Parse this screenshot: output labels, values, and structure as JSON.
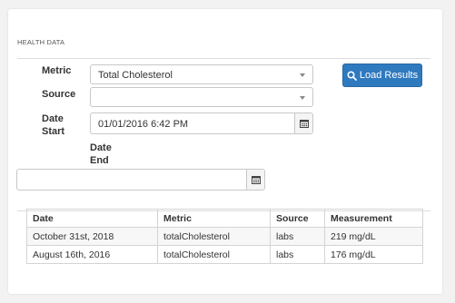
{
  "section_title": "HEALTH DATA",
  "form": {
    "metric_label": "Metric",
    "metric_value": "Total Cholesterol",
    "source_label": "Source",
    "source_value": "",
    "date_start_label_line1": "Date",
    "date_start_label_line2": "Start",
    "date_start_value": "01/01/2016 6:42 PM",
    "date_end_label_line1": "Date",
    "date_end_label_line2": "End",
    "date_end_value": ""
  },
  "load_button_label": "Load Results",
  "table": {
    "headers": [
      "Date",
      "Metric",
      "Source",
      "Measurement"
    ],
    "rows": [
      [
        "October 31st, 2018",
        "totalCholesterol",
        "labs",
        "219 mg/dL"
      ],
      [
        "August 16th, 2016",
        "totalCholesterol",
        "labs",
        "176 mg/dL"
      ]
    ]
  },
  "colors": {
    "button": "#2f79bf",
    "page_bg": "#f2f2f2"
  }
}
